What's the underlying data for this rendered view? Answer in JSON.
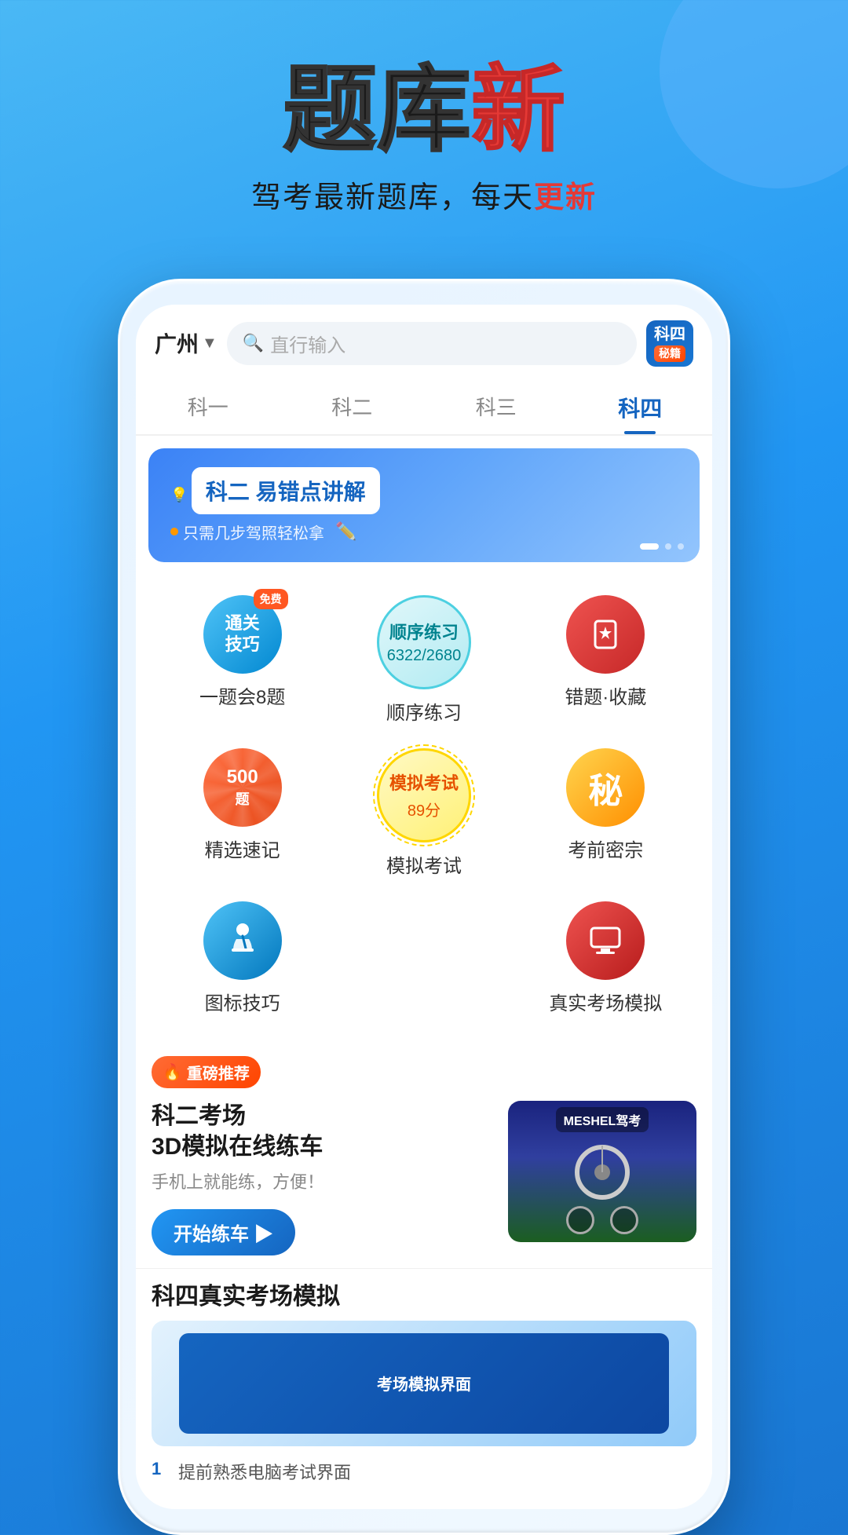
{
  "hero": {
    "title_black": "题库",
    "title_red": "新",
    "subtitle_normal": "驾考最新题库，每天",
    "subtitle_red": "更新"
  },
  "app_header": {
    "city": "广州",
    "city_chevron": "▼",
    "search_placeholder": "直行输入",
    "ke4_label1": "科四",
    "ke4_label2": "秘籍"
  },
  "nav_tabs": {
    "items": [
      {
        "label": "科一",
        "active": false
      },
      {
        "label": "科二",
        "active": false
      },
      {
        "label": "科三",
        "active": false
      },
      {
        "label": "科四",
        "active": true
      }
    ]
  },
  "banner": {
    "tag": "💡",
    "title": "科二 易错点讲解",
    "subtitle_dot": "·",
    "subtitle": "只需几步驾照轻松拿",
    "dots": [
      "active",
      "inactive",
      "inactive",
      "inactive"
    ]
  },
  "grid_items": {
    "tongguan": {
      "label": "通关\n技巧",
      "badge": "免费",
      "sublabel": "一题会8题"
    },
    "sequential": {
      "title": "顺序练习",
      "count": "6322/2680",
      "sublabel": "顺序练习"
    },
    "error_collect": {
      "sublabel": "错题·收藏"
    },
    "speed_memory": {
      "num": "500",
      "unit": "题",
      "sublabel": "精选速记"
    },
    "mock_exam": {
      "title": "模拟考试",
      "score": "89分",
      "sublabel": "模拟考试"
    },
    "secret": {
      "label": "秘",
      "sublabel": "考前密宗"
    },
    "technique": {
      "sublabel": "图标技巧"
    },
    "real_exam": {
      "sublabel": "真实考场模拟"
    }
  },
  "recommendation": {
    "badge_fire": "🔥",
    "badge_text": "重磅推荐",
    "title_line1": "科二考场",
    "title_line2": "3D模拟在线练车",
    "subtitle": "手机上就能练，方便！",
    "button": "开始练车 ▶",
    "image_text": "MESHEL驾考"
  },
  "rec2": {
    "title": "科四真实考场模拟",
    "list_items": [
      "1  提前熟悉电脑考试界面"
    ]
  },
  "colors": {
    "primary_blue": "#1565c0",
    "accent_red": "#e53935",
    "orange": "#ff5722",
    "teal": "#4dd0e1",
    "yellow": "#ffd600"
  }
}
